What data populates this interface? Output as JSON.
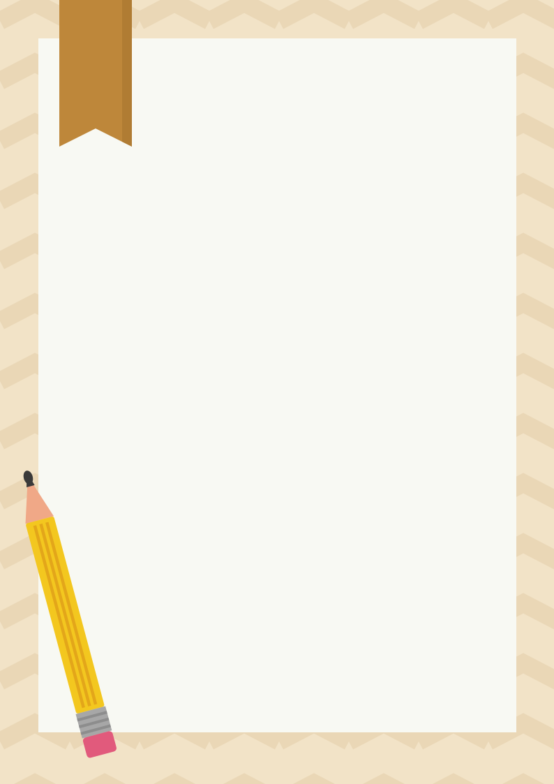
{
  "colors": {
    "background_light": "#f2e3c7",
    "background_stripe": "#ead7b6",
    "sheet": "#f8f9f3",
    "bookmark": "#be873a",
    "pencil_body": "#f3c71f",
    "pencil_stripe": "#e3a61a",
    "pencil_wood": "#f0a887",
    "pencil_lead": "#3a3a3a",
    "pencil_ferrule": "#a7a7a7",
    "pencil_eraser": "#e15a7c"
  },
  "decorations": {
    "background": "chevron-pattern",
    "ribbon": "bookmark-ribbon-icon",
    "pencil": "pencil-icon"
  }
}
